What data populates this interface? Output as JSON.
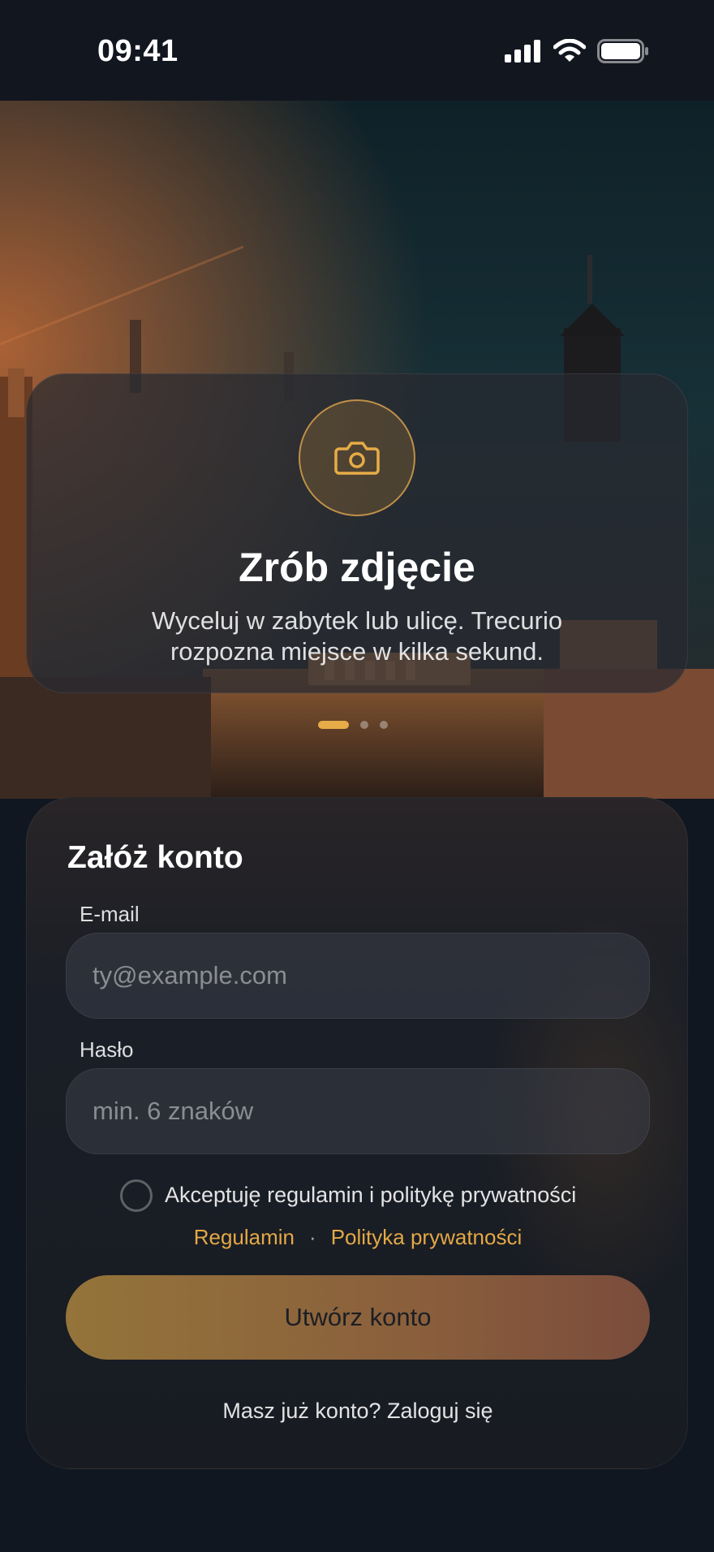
{
  "status_bar": {
    "time": "09:41",
    "signal_icon": "cellular-signal-icon",
    "wifi_icon": "wifi-icon",
    "battery_icon": "battery-icon"
  },
  "onboarding": {
    "icon": "camera-icon",
    "title": "Zrób zdjęcie",
    "description": "Wyceluj w zabytek lub ulicę. Trecurio rozpozna miejsce w kilka sekund.",
    "page_count": 3,
    "active_page": 1
  },
  "signup": {
    "title": "Załóż konto",
    "email_label": "E-mail",
    "email_placeholder": "ty@example.com",
    "email_value": "",
    "password_label": "Hasło",
    "password_placeholder": "min. 6 znaków",
    "password_value": "",
    "terms_checkbox_label": "Akceptuję regulamin i politykę prywatności",
    "terms_checked": false,
    "terms_link": "Regulamin",
    "privacy_link": "Polityka prywatności",
    "separator": "·",
    "create_button": "Utwórz konto",
    "login_prompt": "Masz już konto? Zaloguj się"
  },
  "colors": {
    "accent": "#e7ac47",
    "background": "#111720",
    "button_gradient_start": "#94743a",
    "button_gradient_end": "#7a4c3c"
  }
}
